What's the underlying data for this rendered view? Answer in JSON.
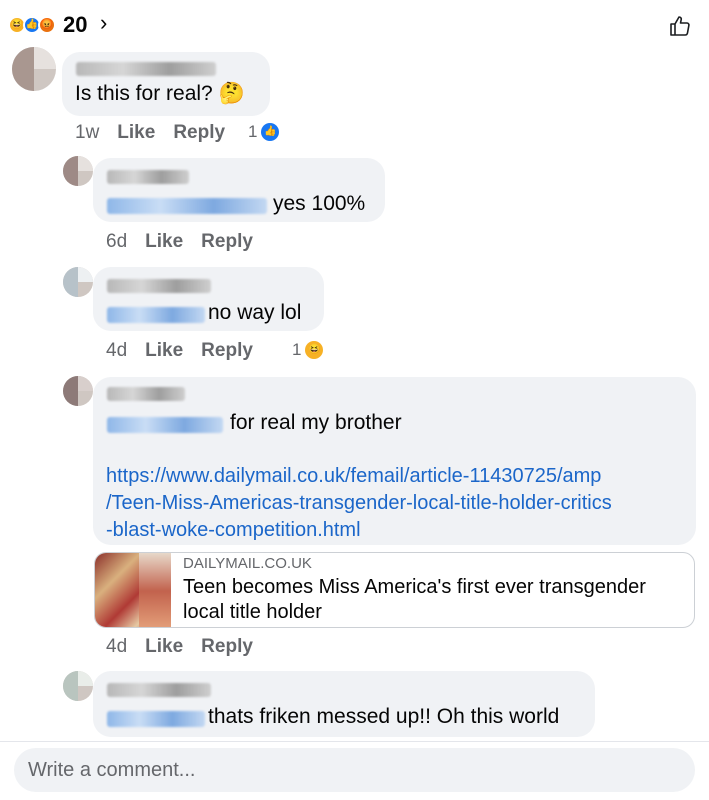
{
  "header": {
    "reaction_count": "20",
    "reactions": [
      "haha-icon",
      "like-icon",
      "angry-icon"
    ],
    "chevron": "›"
  },
  "comments": [
    {
      "text": "Is this for real? 🤔",
      "meta": {
        "time": "1w",
        "like": "Like",
        "reply": "Reply"
      },
      "reaction_count": "1",
      "reaction_icon": "like-icon"
    },
    {
      "text": "yes 100%",
      "meta": {
        "time": "6d",
        "like": "Like",
        "reply": "Reply"
      }
    },
    {
      "text": "no way lol",
      "meta": {
        "time": "4d",
        "like": "Like",
        "reply": "Reply"
      },
      "reaction_count": "1",
      "reaction_icon": "haha-icon"
    },
    {
      "text": "for real my brother",
      "link_lines": [
        "https://www.dailymail.co.uk/femail/article-11430725/amp",
        "/Teen-Miss-Americas-transgender-local-title-holder-critics",
        "-blast-woke-competition.html"
      ],
      "preview": {
        "domain": "DAILYMAIL.CO.UK",
        "title": "Teen becomes Miss America's first ever transgender local title holder"
      },
      "meta": {
        "time": "4d",
        "like": "Like",
        "reply": "Reply"
      }
    },
    {
      "text": "thats friken messed up!! Oh this world"
    }
  ],
  "composer": {
    "placeholder": "Write a comment..."
  },
  "colors": {
    "link": "#1b66c9",
    "bubble": "#f0f2f5",
    "like_blue": "#1877f2"
  }
}
